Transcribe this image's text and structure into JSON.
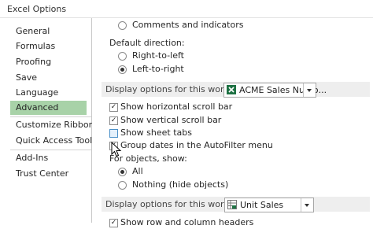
{
  "window": {
    "title": "Excel Options"
  },
  "sidebar": {
    "items": [
      {
        "label": "General",
        "active": false
      },
      {
        "label": "Formulas",
        "active": false
      },
      {
        "label": "Proofing",
        "active": false
      },
      {
        "label": "Save",
        "active": false
      },
      {
        "label": "Language",
        "active": false
      },
      {
        "label": "Advanced",
        "active": true
      },
      {
        "label": "Customize Ribbon",
        "active": false
      },
      {
        "label": "Quick Access Toolbar",
        "active": false
      },
      {
        "label": "Add-Ins",
        "active": false
      },
      {
        "label": "Trust Center",
        "active": false
      }
    ]
  },
  "content": {
    "comments_label": "Comments and indicators",
    "default_direction": {
      "label": "Default direction:",
      "options": [
        {
          "label": "Right-to-left",
          "selected": false
        },
        {
          "label": "Left-to-right",
          "selected": true
        }
      ]
    },
    "workbook_section": {
      "header": "Display options for this workbook:",
      "selected_workbook": "ACME Sales Numb...",
      "options": [
        {
          "label": "Show horizontal scroll bar",
          "checked": true
        },
        {
          "label": "Show vertical scroll bar",
          "checked": true
        },
        {
          "label": "Show sheet tabs",
          "checked": false
        },
        {
          "label": "Group dates in the AutoFilter menu",
          "checked": true
        }
      ],
      "objects_label": "For objects, show:",
      "objects_options": [
        {
          "label": "All",
          "selected": true
        },
        {
          "label": "Nothing (hide objects)",
          "selected": false
        }
      ]
    },
    "worksheet_section": {
      "header": "Display options for this worksheet:",
      "selected_worksheet": "Unit Sales",
      "options": [
        {
          "label": "Show row and column headers",
          "checked": true
        }
      ]
    }
  },
  "colors": {
    "active_nav": "#a8d2a8",
    "excel_green": "#1f7244"
  }
}
